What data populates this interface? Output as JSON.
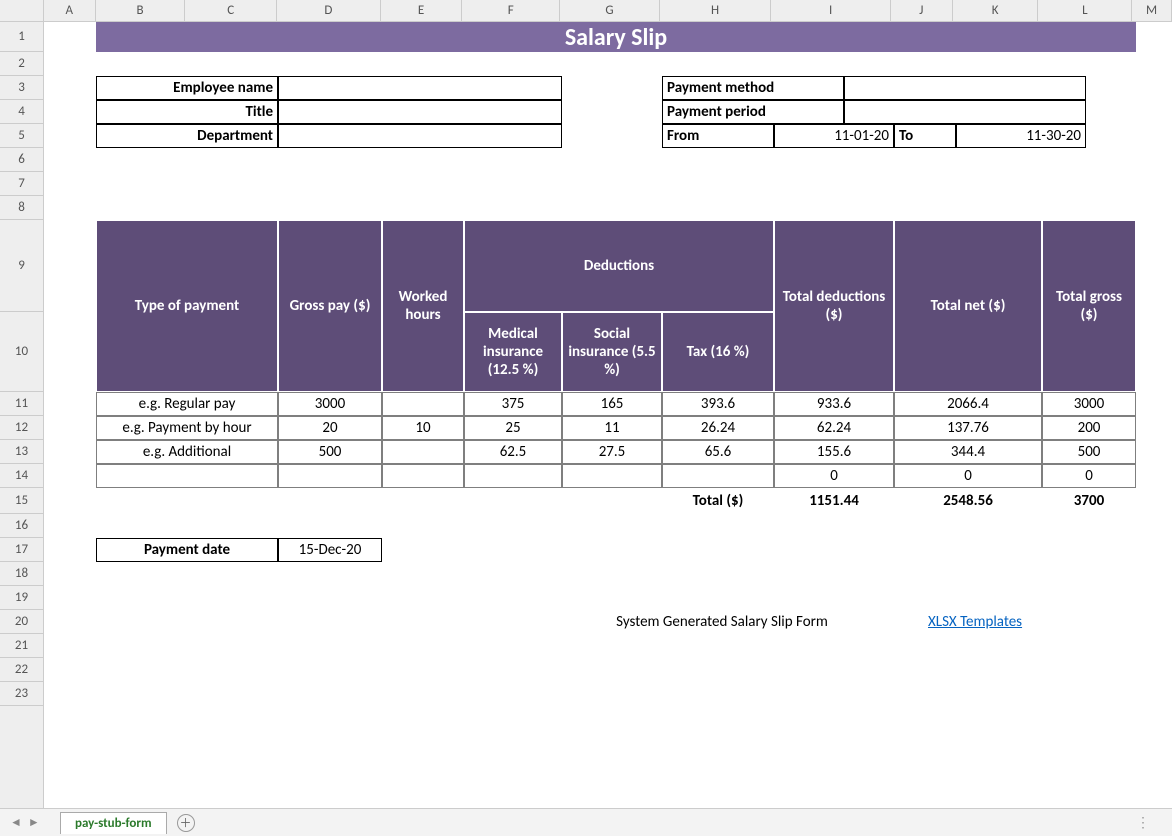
{
  "columns": [
    "A",
    "B",
    "C",
    "D",
    "E",
    "F",
    "G",
    "H",
    "I",
    "J",
    "K",
    "L",
    "M"
  ],
  "rows": [
    "1",
    "2",
    "3",
    "4",
    "5",
    "6",
    "7",
    "8",
    "9",
    "10",
    "11",
    "12",
    "13",
    "14",
    "15",
    "16",
    "17",
    "18",
    "19",
    "20",
    "21",
    "22",
    "23"
  ],
  "title": "Salary Slip",
  "info": {
    "emp_name_label": "Employee name",
    "title_label": "Title",
    "dept_label": "Department",
    "pay_method_label": "Payment method",
    "pay_period_label": "Payment period",
    "from_label": "From",
    "from_value": "11-01-20",
    "to_label": "To",
    "to_value": "11-30-20"
  },
  "headers": {
    "type_of_payment": "Type of payment",
    "gross_pay": "Gross pay ($)",
    "worked_hours": "Worked hours",
    "deductions": "Deductions",
    "medical": "Medical insurance (12.5 %)",
    "social": "Social insurance (5.5 %)",
    "tax": "Tax (16 %)",
    "total_deductions": "Total deductions ($)",
    "total_net": "Total net ($)",
    "total_gross": "Total gross ($)"
  },
  "rows_data": [
    {
      "type": "e.g. Regular pay",
      "gross": "3000",
      "hours": "",
      "med": "375",
      "soc": "165",
      "tax": "393.6",
      "tded": "933.6",
      "net": "2066.4",
      "tgross": "3000"
    },
    {
      "type": "e.g. Payment by hour",
      "gross": "20",
      "hours": "10",
      "med": "25",
      "soc": "11",
      "tax": "26.24",
      "tded": "62.24",
      "net": "137.76",
      "tgross": "200"
    },
    {
      "type": "e.g. Additional",
      "gross": "500",
      "hours": "",
      "med": "62.5",
      "soc": "27.5",
      "tax": "65.6",
      "tded": "155.6",
      "net": "344.4",
      "tgross": "500"
    },
    {
      "type": "",
      "gross": "",
      "hours": "",
      "med": "",
      "soc": "",
      "tax": "",
      "tded": "0",
      "net": "0",
      "tgross": "0"
    }
  ],
  "totals": {
    "label": "Total ($)",
    "tded": "1151.44",
    "net": "2548.56",
    "tgross": "3700"
  },
  "payment_date": {
    "label": "Payment date",
    "value": "15-Dec-20"
  },
  "footer": {
    "text": "System Generated Salary Slip Form",
    "link": "XLSX Templates"
  },
  "tab": "pay-stub-form"
}
